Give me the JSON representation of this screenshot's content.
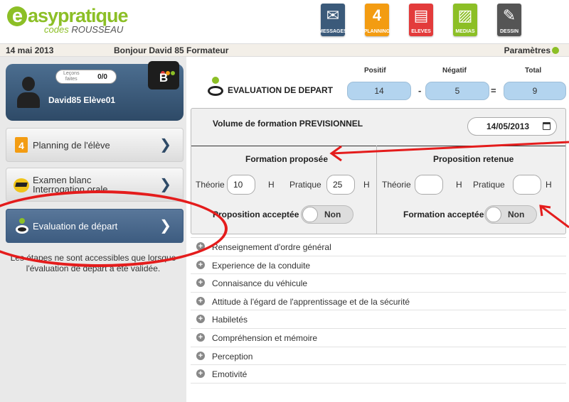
{
  "brand": {
    "name_prefix": "e",
    "name_rest": "asypratique",
    "sub_prefix": "codes ",
    "sub_rest": "ROUSSEAU"
  },
  "topnav": [
    {
      "label": "MESSAGES",
      "icon": "envelope-icon",
      "color": "#3b5a7a",
      "glyph": "✉"
    },
    {
      "label": "PLANNING",
      "icon": "calendar-icon",
      "color": "#f39c12",
      "glyph": "4"
    },
    {
      "label": "ELEVES",
      "icon": "students-icon",
      "color": "#e33b3b",
      "glyph": "▤"
    },
    {
      "label": "MEDIAS",
      "icon": "image-icon",
      "color": "#8cbf26",
      "glyph": "▨"
    },
    {
      "label": "DESSIN",
      "icon": "pencil-icon",
      "color": "#555555",
      "glyph": "✎"
    }
  ],
  "subbar": {
    "date": "14 mai 2013",
    "greeting": "Bonjour David 85 Formateur",
    "settings": "Paramètres"
  },
  "student": {
    "lecons_label": "Leçons\nfaites",
    "lecons_value": "0/0",
    "name": "David85 Elève01",
    "badge": "B"
  },
  "sidebar": {
    "items": [
      {
        "label": "Planning de l'élève",
        "icon": "calendar-icon",
        "active": false
      },
      {
        "label": "Examen blanc\nInterrogation orale",
        "icon": "graduation-cap-icon",
        "active": false
      },
      {
        "label": "Evaluation de départ",
        "icon": "evaluation-icon",
        "active": true
      }
    ],
    "note": "Les étapes ne sont accessibles que lorsque l'évaluation de départ a été validée."
  },
  "evaluation": {
    "title": "EVALUATION DE DEPART",
    "headers": {
      "positif": "Positif",
      "negatif": "Négatif",
      "total": "Total"
    },
    "positif": "14",
    "negatif": "5",
    "total": "9",
    "op_minus": "-",
    "op_equals": "="
  },
  "formation": {
    "volume_title": "Volume de formation PREVISIONNEL",
    "date": "14/05/2013",
    "proposed_title": "Formation proposée",
    "retained_title": "Proposition retenue",
    "theorie_label": "Théorie",
    "pratique_label": "Pratique",
    "unit": "H",
    "proposed_theorie": "10",
    "proposed_pratique": "25",
    "retained_theorie": "",
    "retained_pratique": "",
    "proposition_acceptee_label": "Proposition acceptée",
    "formation_acceptee_label": "Formation acceptée",
    "toggle_off": "Non"
  },
  "accordion": [
    "Renseignement d'ordre général",
    "Experience de la conduite",
    "Connaisance du véhicule",
    "Attitude à l'égard de l'apprentissage et de la sécurité",
    "Habiletés",
    "Compréhension et mémoire",
    "Perception",
    "Emotivité"
  ],
  "colors": {
    "brand_green": "#8cbf26",
    "score_blue": "#b3d4ef",
    "nav_active": "#3d5c80",
    "annotation_red": "#e41c1c"
  }
}
